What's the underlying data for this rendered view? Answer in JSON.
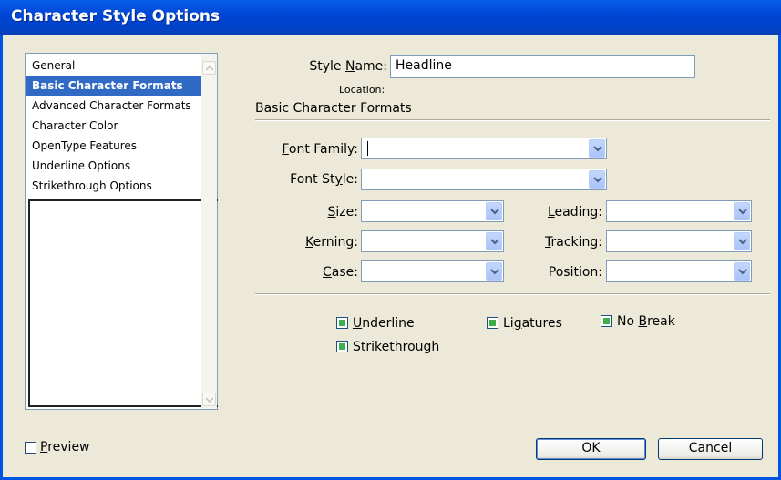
{
  "window": {
    "title": "Character Style Options"
  },
  "categories": [
    {
      "label": "General",
      "selected": false
    },
    {
      "label": "Basic Character Formats",
      "selected": true
    },
    {
      "label": "Advanced Character Formats",
      "selected": false
    },
    {
      "label": "Character Color",
      "selected": false
    },
    {
      "label": "OpenType Features",
      "selected": false
    },
    {
      "label": "Underline Options",
      "selected": false
    },
    {
      "label": "Strikethrough Options",
      "selected": false
    }
  ],
  "style_name": {
    "label_pre": "Style ",
    "label_key": "N",
    "label_post": "ame:",
    "value": "Headline"
  },
  "location": {
    "label": "Location:"
  },
  "section_title": "Basic Character Formats",
  "fields": {
    "font_family": {
      "label_key": "F",
      "label_post": "ont Family:",
      "value": ""
    },
    "font_style": {
      "label_pre": "Font St",
      "label_key": "y",
      "label_post": "le:",
      "value": ""
    },
    "size": {
      "label_key": "S",
      "label_post": "ize:",
      "value": ""
    },
    "leading": {
      "label_key": "L",
      "label_post": "eading:",
      "value": ""
    },
    "kerning": {
      "label_key": "K",
      "label_post": "erning:",
      "value": ""
    },
    "tracking": {
      "label_key": "T",
      "label_post": "racking:",
      "value": ""
    },
    "case": {
      "label_key": "C",
      "label_post": "ase:",
      "value": ""
    },
    "position": {
      "label": "Position:",
      "value": ""
    }
  },
  "checkboxes": {
    "underline": {
      "label_key": "U",
      "label_post": "nderline",
      "checked": true
    },
    "ligatures": {
      "label_pre": "Li",
      "label_key": "g",
      "label_post": "atures",
      "checked": true
    },
    "no_break": {
      "label_pre": "No ",
      "label_key": "B",
      "label_post": "reak",
      "checked": true
    },
    "strikethrough": {
      "label_pre": "St",
      "label_key": "r",
      "label_post": "ikethrough",
      "checked": true
    }
  },
  "preview": {
    "label_key": "P",
    "label_post": "review",
    "checked": false
  },
  "buttons": {
    "ok": "OK",
    "cancel": "Cancel"
  },
  "colors": {
    "titlebar": "#0047d6",
    "dialog_bg": "#ece9d8",
    "selection": "#316ac5",
    "checkbox_fill": "#3fae49"
  },
  "icons": {
    "dropdown": "chevron-down-icon",
    "scroll_up": "scroll-up-arrow-icon",
    "scroll_down": "scroll-down-arrow-icon"
  }
}
